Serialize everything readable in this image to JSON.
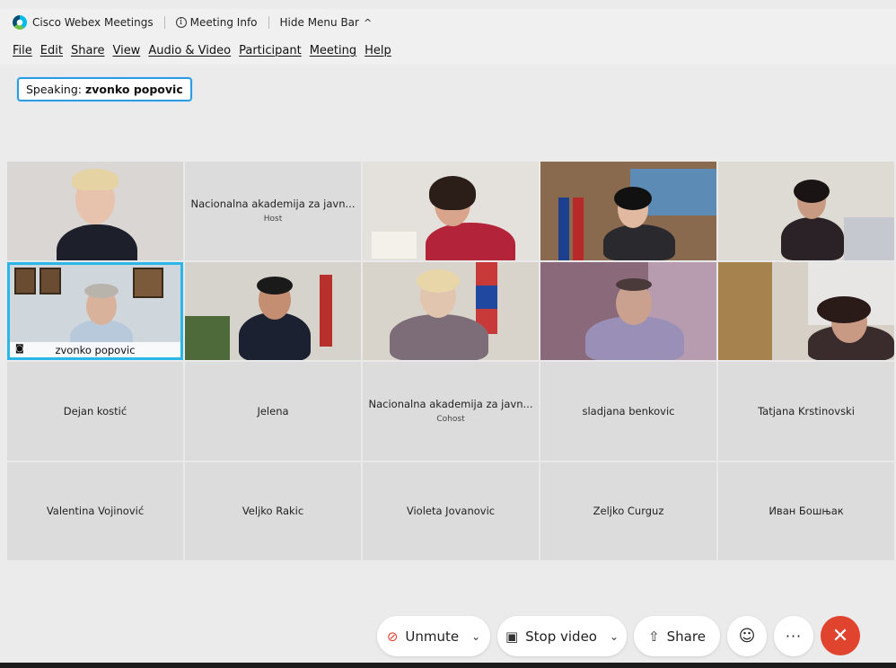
{
  "titlebar": {
    "app_name": "Cisco Webex Meetings",
    "meeting_info": "Meeting Info",
    "hide_menu": "Hide Menu Bar"
  },
  "menu": [
    {
      "label": "File"
    },
    {
      "label": "Edit"
    },
    {
      "label": "Share"
    },
    {
      "label": "View"
    },
    {
      "label": "Audio & Video"
    },
    {
      "label": "Participant"
    },
    {
      "label": "Meeting"
    },
    {
      "label": "Help"
    }
  ],
  "speaking": {
    "label": "Speaking:",
    "name": "zvonko popovic"
  },
  "participants": [
    {
      "name": "",
      "role": "",
      "video": true
    },
    {
      "name": "Nacionalna akademija za javn...",
      "role": "Host",
      "video": false
    },
    {
      "name": "",
      "role": "",
      "video": true
    },
    {
      "name": "",
      "role": "",
      "video": true
    },
    {
      "name": "",
      "role": "",
      "video": true
    },
    {
      "name": "zvonko popovic",
      "role": "",
      "video": true,
      "active": true
    },
    {
      "name": "",
      "role": "",
      "video": true
    },
    {
      "name": "",
      "role": "",
      "video": true
    },
    {
      "name": "",
      "role": "",
      "video": true
    },
    {
      "name": "",
      "role": "",
      "video": true
    },
    {
      "name": "Dejan kostić",
      "role": "",
      "video": false
    },
    {
      "name": "Jelena",
      "role": "",
      "video": false
    },
    {
      "name": "Nacionalna akademija za javn...",
      "role": "Cohost",
      "video": false
    },
    {
      "name": "sladjana benkovic",
      "role": "",
      "video": false
    },
    {
      "name": "Tatjana Krstinovski",
      "role": "",
      "video": false
    },
    {
      "name": "Valentina Vojinović",
      "role": "",
      "video": false
    },
    {
      "name": "Veljko Rakic",
      "role": "",
      "video": false
    },
    {
      "name": "Violeta Jovanovic",
      "role": "",
      "video": false
    },
    {
      "name": "Zeljko Curguz",
      "role": "",
      "video": false
    },
    {
      "name": "Иван Бошњак",
      "role": "",
      "video": false
    }
  ],
  "controls": {
    "unmute": "Unmute",
    "stop_video": "Stop video",
    "share": "Share"
  },
  "icons": {
    "mic_muted": "mic-muted-icon",
    "video": "video-camera-icon",
    "share": "share-upload-icon",
    "reactions": "smiley-icon",
    "more": "more-dots-icon",
    "end": "close-x-icon"
  },
  "colors": {
    "active_speaker_border": "#2ab6e6",
    "end_button": "#e0432e",
    "mic_muted": "#e0432e",
    "speaking_border": "#2e9ae0"
  }
}
